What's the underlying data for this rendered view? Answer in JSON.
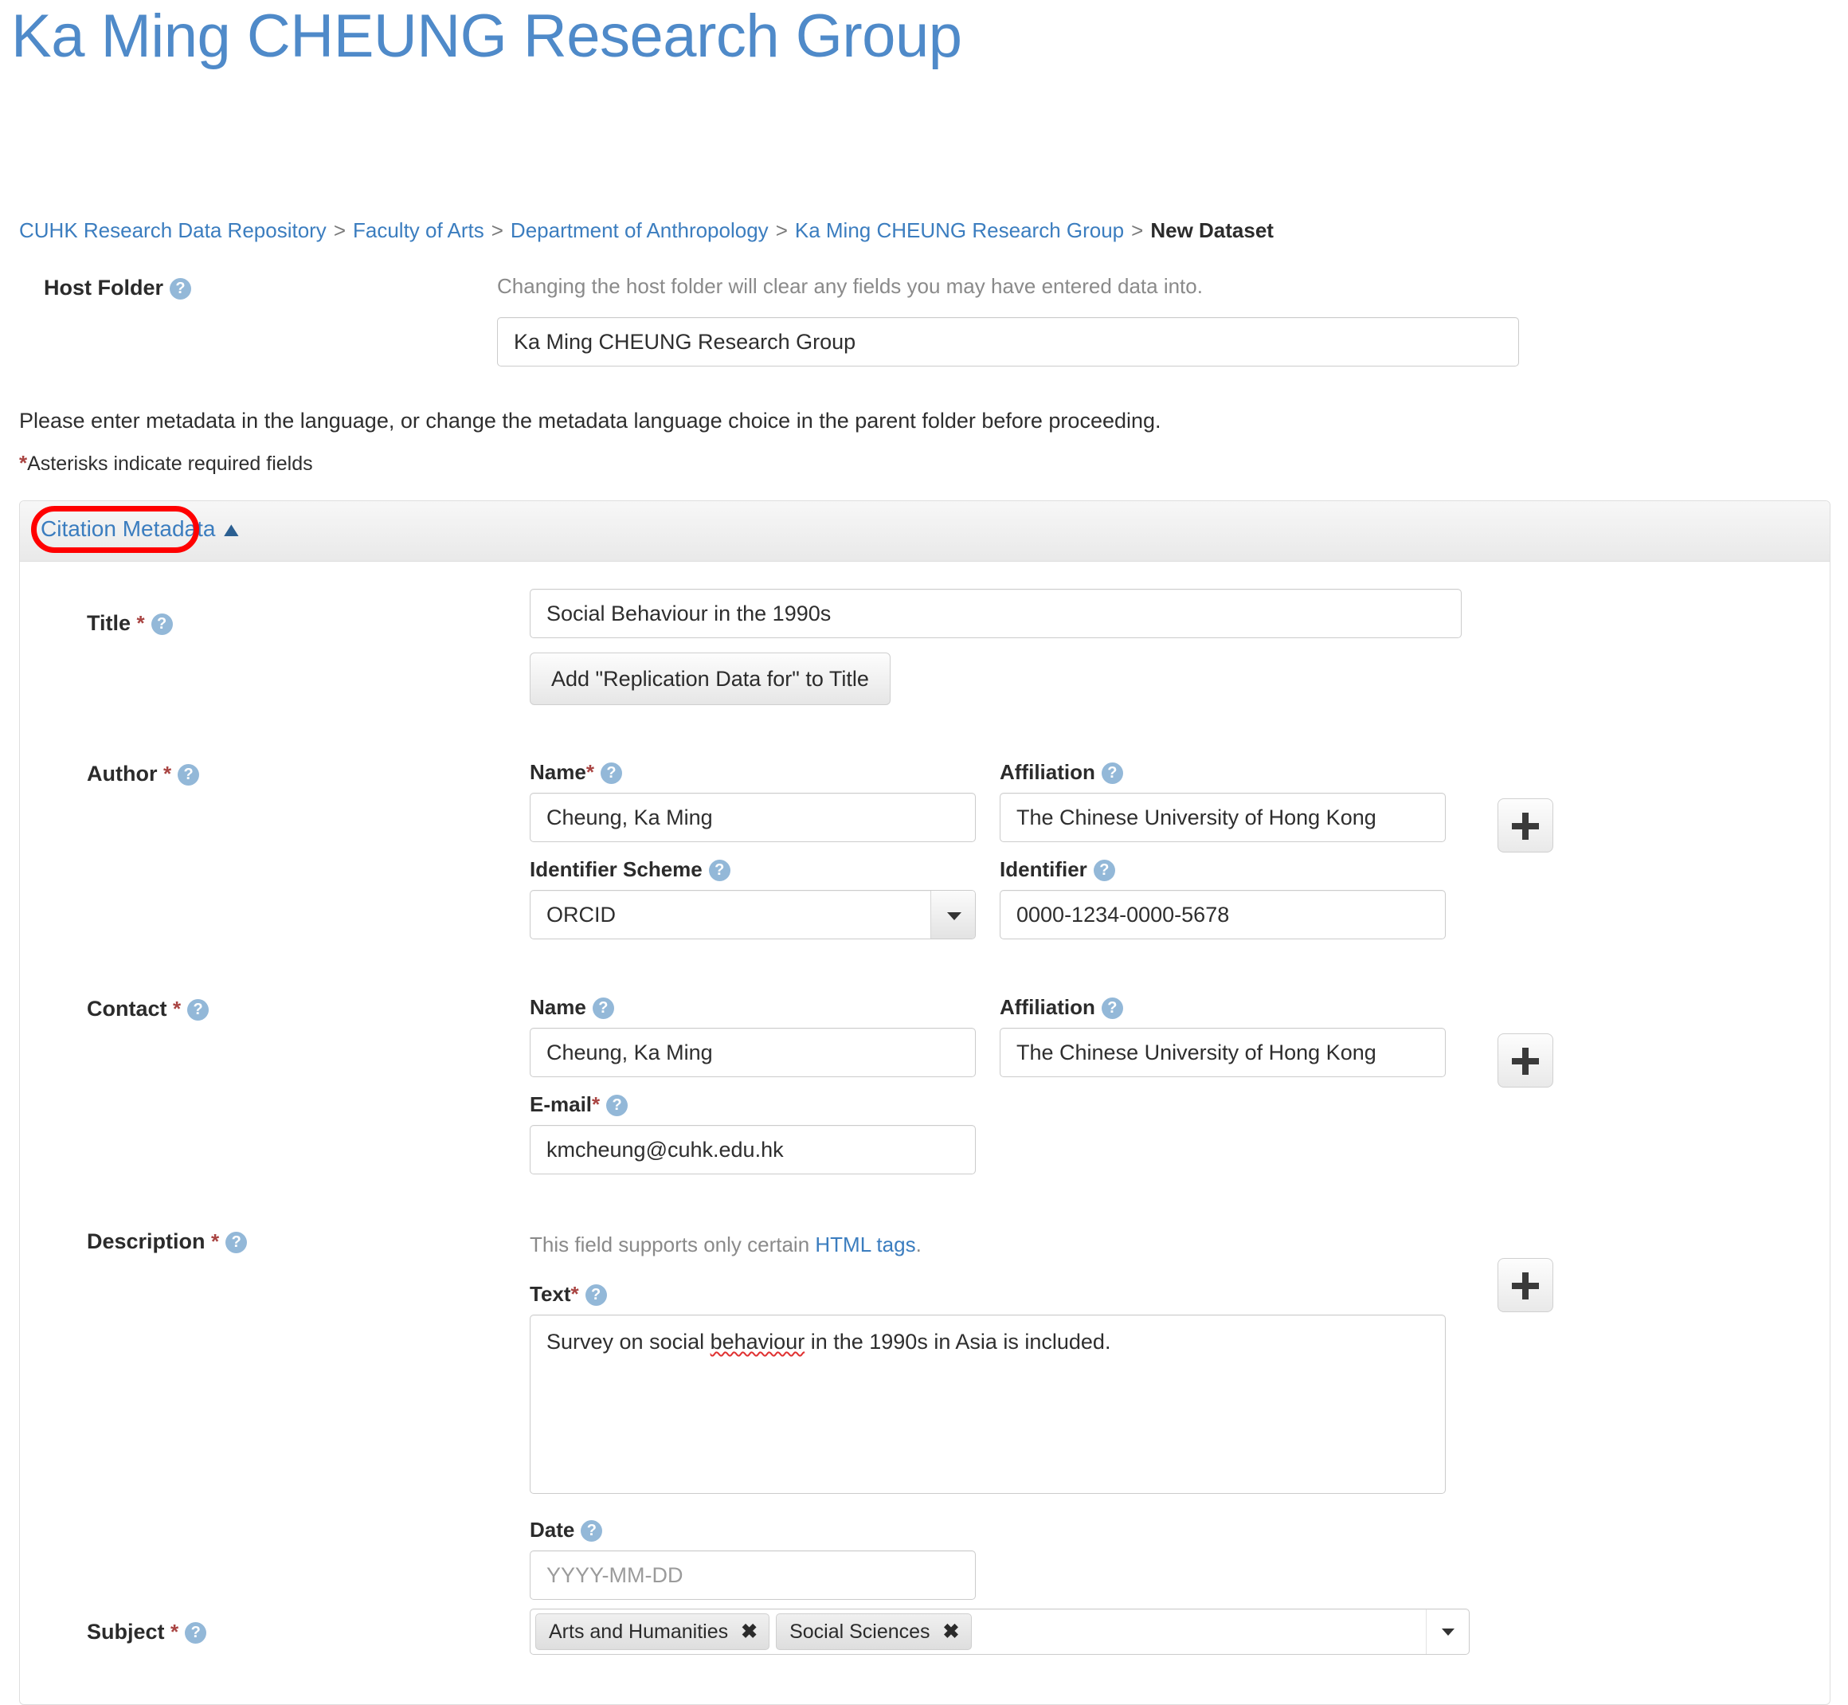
{
  "header": {
    "site_title": "Ka Ming CHEUNG Research Group"
  },
  "breadcrumb": {
    "items": [
      "CUHK Research Data Repository",
      "Faculty of Arts",
      "Department of Anthropology",
      "Ka Ming CHEUNG Research Group"
    ],
    "separator": ">",
    "current": "New Dataset"
  },
  "host_folder": {
    "label": "Host Folder",
    "help_icon": "question-mark-icon",
    "note": "Changing the host folder will clear any fields you may have entered data into.",
    "value": "Ka Ming CHEUNG Research Group"
  },
  "instructions": {
    "language_note": "Please enter metadata in the language, or change the metadata language choice in the parent folder before proceeding.",
    "asterisk_star": "*",
    "asterisk_note": "Asterisks indicate required fields"
  },
  "panel": {
    "title": "Citation Metadata",
    "caret": "▲",
    "highlight_color": "#ff0000"
  },
  "fields": {
    "title": {
      "label": "Title",
      "required_star": "*",
      "value": "Social Behaviour in the 1990s",
      "button_label": "Add \"Replication Data for\" to Title"
    },
    "author": {
      "label": "Author",
      "required_star": "*",
      "name_label": "Name",
      "name_required_star": "*",
      "name_value": "Cheung, Ka Ming",
      "affiliation_label": "Affiliation",
      "affiliation_value": "The Chinese University of Hong Kong",
      "identifier_scheme_label": "Identifier Scheme",
      "identifier_scheme_value": "ORCID",
      "identifier_label": "Identifier",
      "identifier_value": "0000-1234-0000-5678",
      "add_button": "+"
    },
    "contact": {
      "label": "Contact",
      "required_star": "*",
      "name_label": "Name",
      "name_value": "Cheung, Ka Ming",
      "affiliation_label": "Affiliation",
      "affiliation_value": "The Chinese University of Hong Kong",
      "email_label": "E-mail",
      "email_required_star": "*",
      "email_value": "kmcheung@cuhk.edu.hk",
      "add_button": "+"
    },
    "description": {
      "label": "Description",
      "required_star": "*",
      "html_note_prefix": "This field supports only certain ",
      "html_note_link": "HTML tags",
      "html_note_suffix": ".",
      "text_label": "Text",
      "text_required_star": "*",
      "text_value_part1": "Survey on social ",
      "text_value_misspelled": "behaviour",
      "text_value_part2": " in the 1990s in Asia is included.",
      "date_label": "Date",
      "date_placeholder": "YYYY-MM-DD",
      "add_button": "+"
    },
    "subject": {
      "label": "Subject",
      "required_star": "*",
      "tags": [
        {
          "label": "Arts and Humanities",
          "remove": "✖"
        },
        {
          "label": "Social Sciences",
          "remove": "✖"
        }
      ]
    }
  }
}
